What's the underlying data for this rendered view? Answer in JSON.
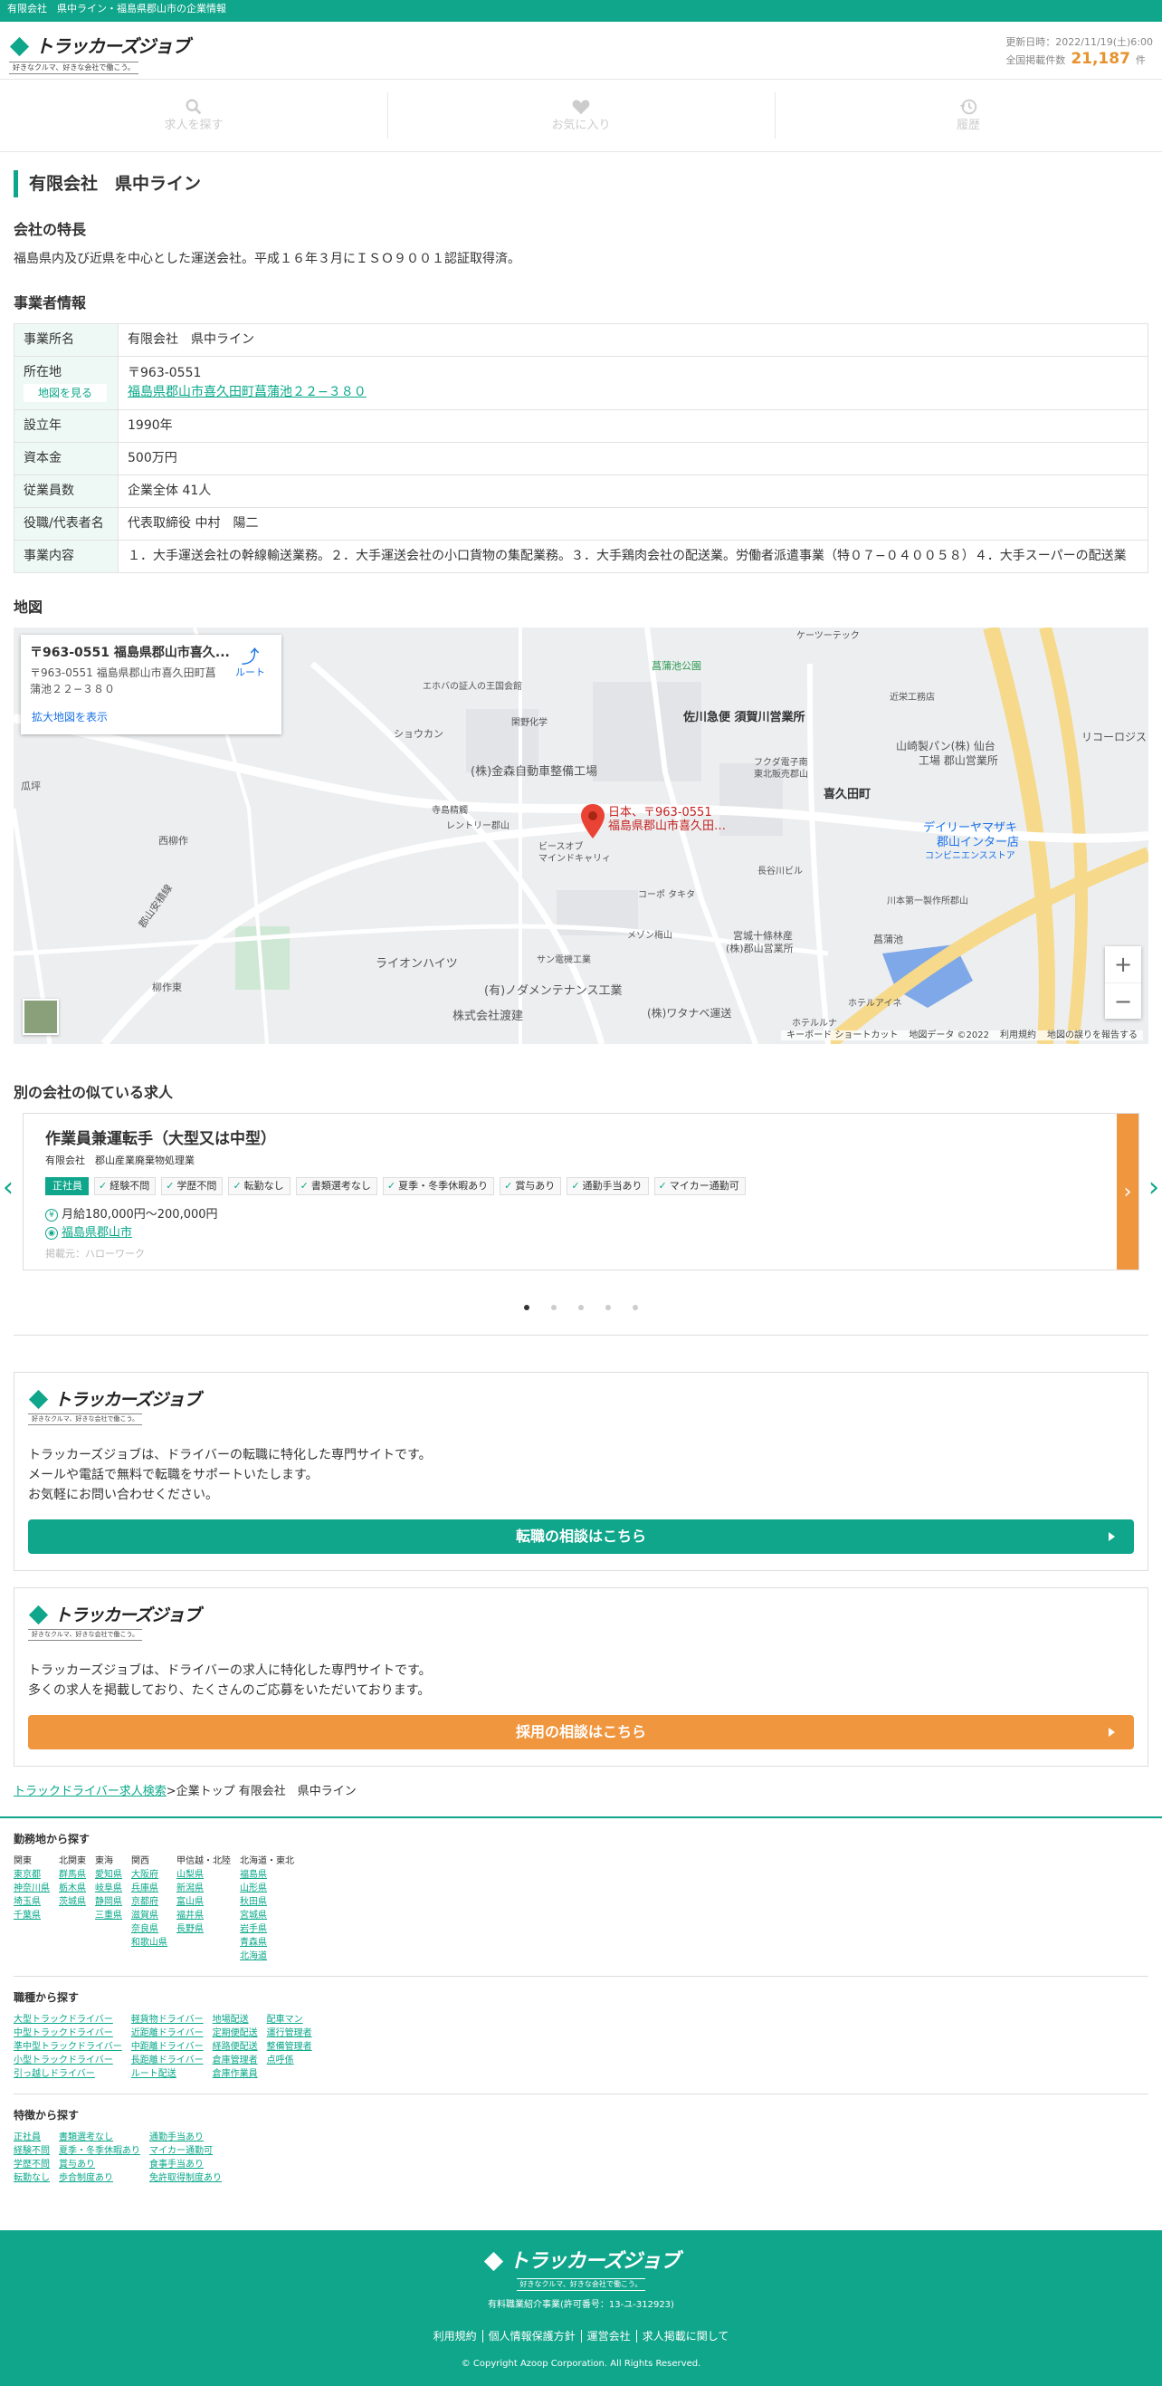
{
  "topbar": {
    "text": "有限会社　県中ライン・福島県郡山市の企業情報"
  },
  "logo": {
    "name": "トラッカーズジョブ",
    "tagline": "好きなクルマ、好きな会社で働こう。"
  },
  "update": {
    "label": "更新日時：2022/11/19(土)6:00",
    "count_label": "全国掲載件数",
    "count": "21,187",
    "unit": "件"
  },
  "nav": [
    {
      "label": "求人を探す",
      "icon": "search-icon"
    },
    {
      "label": "お気に入り",
      "icon": "heart-icon"
    },
    {
      "label": "履歴",
      "icon": "history-icon"
    }
  ],
  "page_title": "有限会社　県中ライン",
  "features": {
    "heading": "会社の特長",
    "text": "福島県内及び近県を中心とした運送会社。平成１６年３月にＩＳＯ９００１認証取得済。"
  },
  "business": {
    "heading": "事業者情報",
    "rows": [
      {
        "label": "事業所名",
        "value": "有限会社　県中ライン"
      },
      {
        "label": "所在地",
        "zip": "〒963-0551",
        "address": "福島県郡山市喜久田町菖蒲池２２−３８０",
        "map_button": "地図を見る"
      },
      {
        "label": "設立年",
        "value": "1990年"
      },
      {
        "label": "資本金",
        "value": "500万円"
      },
      {
        "label": "従業員数",
        "value": "企業全体 41人"
      },
      {
        "label": "役職/代表者名",
        "value": "代表取締役 中村　陽二"
      },
      {
        "label": "事業内容",
        "value": "１．大手運送会社の幹線輸送業務。２．大手運送会社の小口貨物の集配業務。３．大手鶏肉会社の配送業。労働者派遣事業（特０７−０４００５８）４．大手スーパーの配送業"
      }
    ]
  },
  "map": {
    "heading": "地図",
    "card_title": "〒963-0551 福島県郡山市喜久...",
    "card_address": "〒963-0551 福島県郡山市喜久田町菖蒲池２２−３８０",
    "route": "ルート",
    "enlarge": "拡大地図を表示",
    "pin_label1": "日本、〒963-0551",
    "pin_label2": "福島県郡山市喜久田…",
    "labels": [
      "菖蒲池公園",
      "佐川急便 須賀川営業所",
      "喜久田町",
      "(株)金森自動車整備工場",
      "デイリーヤマザキ",
      "郡山インター店",
      "山崎製パン(株) 仙台",
      "工場 郡山営業所",
      "(有)ノダメンテナンス工業",
      "株式会社渡建",
      "ライオンハイツ",
      "宮城十條林産",
      "(株)郡山営業所",
      "菖蒲池",
      "西柳作",
      "柳作東",
      "郡山安積線",
      "エホバの証人の王国会館",
      "ショウカン",
      "寺島精觸",
      "レントリー郡山",
      "ビースオブ",
      "マインドキャリィ",
      "コーポ タキタ",
      "メゾン梅山",
      "サン電機工業",
      "長谷川ビル",
      "川本第一製作所郡山",
      "ホテルアイネ",
      "ホテルルナ",
      "(株)ワタナベ運送",
      "近栄工務店",
      "リコーロジス",
      "ケーツーテック",
      "フクダ電子南",
      "東北販売郡山",
      "閑野化学",
      "瓜坪",
      "コンビニエンスストア"
    ],
    "footer": [
      "キーボード ショートカット",
      "地図データ ©2022",
      "利用規約",
      "地図の誤りを報告する"
    ]
  },
  "similar": {
    "heading": "別の会社の似ている求人",
    "job_title": "作業員兼運転手（大型又は中型）",
    "company": "有限会社　郡山産業廃棄物処理業",
    "tags": [
      "正社員",
      "経験不問",
      "学歴不問",
      "転勤なし",
      "書類選考なし",
      "夏季・冬季休暇あり",
      "賞与あり",
      "通勤手当あり",
      "マイカー通勤可"
    ],
    "salary": "月給180,000円〜200,000円",
    "location": "福島県郡山市",
    "source": "掲載元：ハローワーク"
  },
  "promo1": {
    "name": "トラッカーズジョブ",
    "tagline": "好きなクルマ、好きな会社で働こう。",
    "lines": [
      "トラッカーズジョブは、ドライバーの転職に特化した専門サイトです。",
      "メールや電話で無料で転職をサポートいたします。",
      "お気軽にお問い合わせください。"
    ],
    "button": "転職の相談はこちら"
  },
  "promo2": {
    "name": "トラッカーズジョブ",
    "tagline": "好きなクルマ、好きな会社で働こう。",
    "lines": [
      "トラッカーズジョブは、ドライバーの求人に特化した専門サイトです。",
      "多くの求人を掲載しており、たくさんのご応募をいただいております。"
    ],
    "button": "採用の相談はこちら"
  },
  "breadcrumb": {
    "link": "トラックドライバー求人検索",
    "rest": ">企業トップ 有限会社　県中ライン"
  },
  "by_area": {
    "heading": "勤務地から探す",
    "columns": [
      {
        "head": "関東",
        "items": [
          "東京都",
          "神奈川県",
          "埼玉県",
          "千葉県"
        ]
      },
      {
        "head": "北関東",
        "items": [
          "群馬県",
          "栃木県",
          "茨城県"
        ]
      },
      {
        "head": "東海",
        "items": [
          "愛知県",
          "岐阜県",
          "静岡県",
          "三重県"
        ]
      },
      {
        "head": "関西",
        "items": [
          "大阪府",
          "兵庫県",
          "京都府",
          "滋賀県",
          "奈良県",
          "和歌山県"
        ]
      },
      {
        "head": "甲信越・北陸",
        "items": [
          "山梨県",
          "新潟県",
          "富山県",
          "福井県",
          "長野県"
        ]
      },
      {
        "head": "北海道・東北",
        "items": [
          "福島県",
          "山形県",
          "秋田県",
          "宮城県",
          "岩手県",
          "青森県",
          "北海道"
        ]
      }
    ]
  },
  "by_job": {
    "heading": "職種から探す",
    "columns": [
      {
        "items": [
          "大型トラックドライバー",
          "中型トラックドライバー",
          "準中型トラックドライバー",
          "小型トラックドライバー",
          "引っ越しドライバー"
        ]
      },
      {
        "items": [
          "軽貨物ドライバー",
          "近距離ドライバー",
          "中距離ドライバー",
          "長距離ドライバー",
          "ルート配送"
        ]
      },
      {
        "items": [
          "地場配送",
          "定期便配送",
          "経路便配送",
          "倉庫管理者",
          "倉庫作業員"
        ]
      },
      {
        "items": [
          "配車マン",
          "運行管理者",
          "整備管理者",
          "点呼係"
        ]
      }
    ]
  },
  "by_feature": {
    "heading": "特徴から探す",
    "columns": [
      {
        "items": [
          "正社員",
          "経験不問",
          "学歴不問",
          "転勤なし"
        ]
      },
      {
        "items": [
          "書類選考なし",
          "夏季・冬季休暇あり",
          "賞与あり",
          "歩合制度あり"
        ]
      },
      {
        "items": [
          "通勤手当あり",
          "マイカー通勤可",
          "食事手当あり",
          "免許取得制度あり"
        ]
      }
    ]
  },
  "footer": {
    "name": "トラッカーズジョブ",
    "tagline": "好きなクルマ、好きな会社で働こう。",
    "license": "有料職業紹介事業(許可番号：13-ユ-312923)",
    "links": [
      "利用規約",
      "個人情報保護方針",
      "運営会社",
      "求人掲載に関して"
    ],
    "copyright": "© Copyright Azoop Corporation. All Rights Reserved."
  },
  "colors": {
    "brand": "#0fa68b",
    "accent": "#f0963e"
  }
}
